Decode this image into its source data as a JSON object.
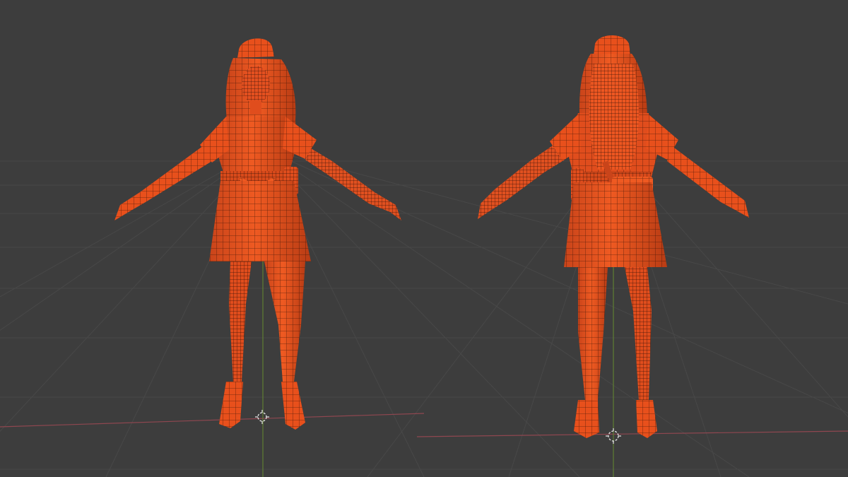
{
  "viewport": {
    "background": "#3d3d3d",
    "grid_color": "#474747",
    "x_axis_color": "#9a4a52",
    "y_axis_color": "#6a8a3a",
    "mesh_color": "#e8501c",
    "mesh_shade": "#b83a12",
    "wire_color": "#1a0a05",
    "origin_icon": "3d-cursor-icon"
  },
  "models": [
    {
      "name": "character-front-view",
      "view": "front"
    },
    {
      "name": "character-back-view",
      "view": "back"
    }
  ]
}
